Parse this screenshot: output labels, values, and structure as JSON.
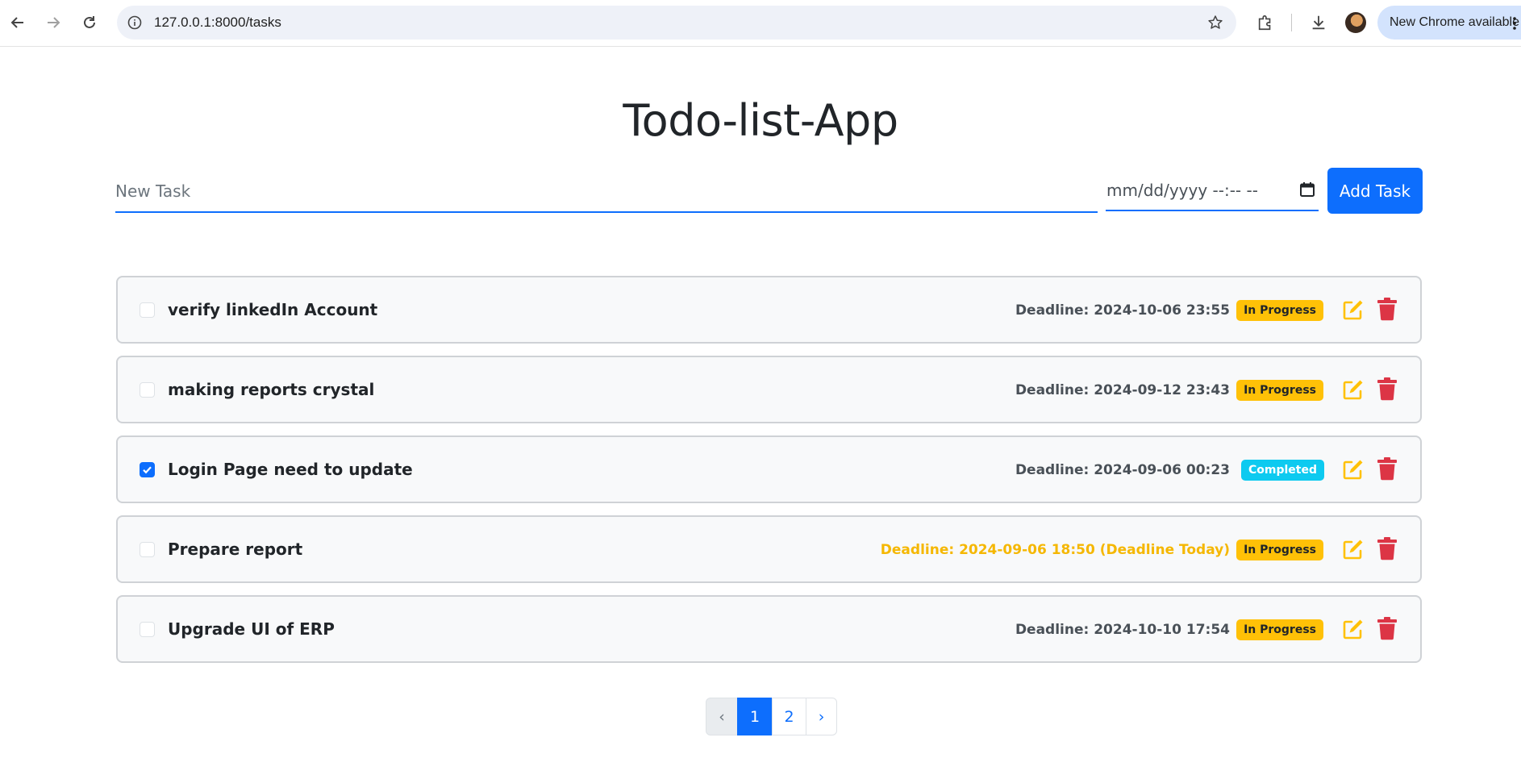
{
  "browser": {
    "url": "127.0.0.1:8000/tasks",
    "update_label": "New Chrome available"
  },
  "app": {
    "title": "Todo-list-App"
  },
  "form": {
    "task_placeholder": "New Task",
    "date_placeholder": "mm/dd/yyyy --:-- --",
    "add_label": "Add Task"
  },
  "tasks": [
    {
      "name": "verify linkedIn Account",
      "deadline": "Deadline: 2024-10-06 23:55",
      "status": "In Progress",
      "checked": false,
      "deadline_today": false
    },
    {
      "name": "making reports crystal",
      "deadline": "Deadline: 2024-09-12 23:43",
      "status": "In Progress",
      "checked": false,
      "deadline_today": false
    },
    {
      "name": "Login Page need to update",
      "deadline": "Deadline: 2024-09-06 00:23",
      "status": "Completed",
      "checked": true,
      "deadline_today": false
    },
    {
      "name": "Prepare report",
      "deadline": "Deadline: 2024-09-06 18:50 (Deadline Today)",
      "status": "In Progress",
      "checked": false,
      "deadline_today": true
    },
    {
      "name": "Upgrade UI of ERP",
      "deadline": "Deadline: 2024-10-10 17:54",
      "status": "In Progress",
      "checked": false,
      "deadline_today": false
    }
  ],
  "pagination": {
    "prev": "‹",
    "pages": [
      "1",
      "2"
    ],
    "current": "1",
    "next": "›"
  },
  "colors": {
    "primary": "#0d6efd",
    "in_progress": "#ffc107",
    "completed": "#0dcaf0",
    "delete": "#dc3545",
    "deadline_today": "#f5b700"
  },
  "icons": [
    "back-arrow-icon",
    "forward-arrow-icon",
    "reload-icon",
    "site-info-icon",
    "bookmark-star-icon",
    "extensions-icon",
    "download-icon",
    "calendar-icon",
    "edit-icon",
    "trash-icon",
    "checkmark-icon",
    "more-vert-icon"
  ]
}
